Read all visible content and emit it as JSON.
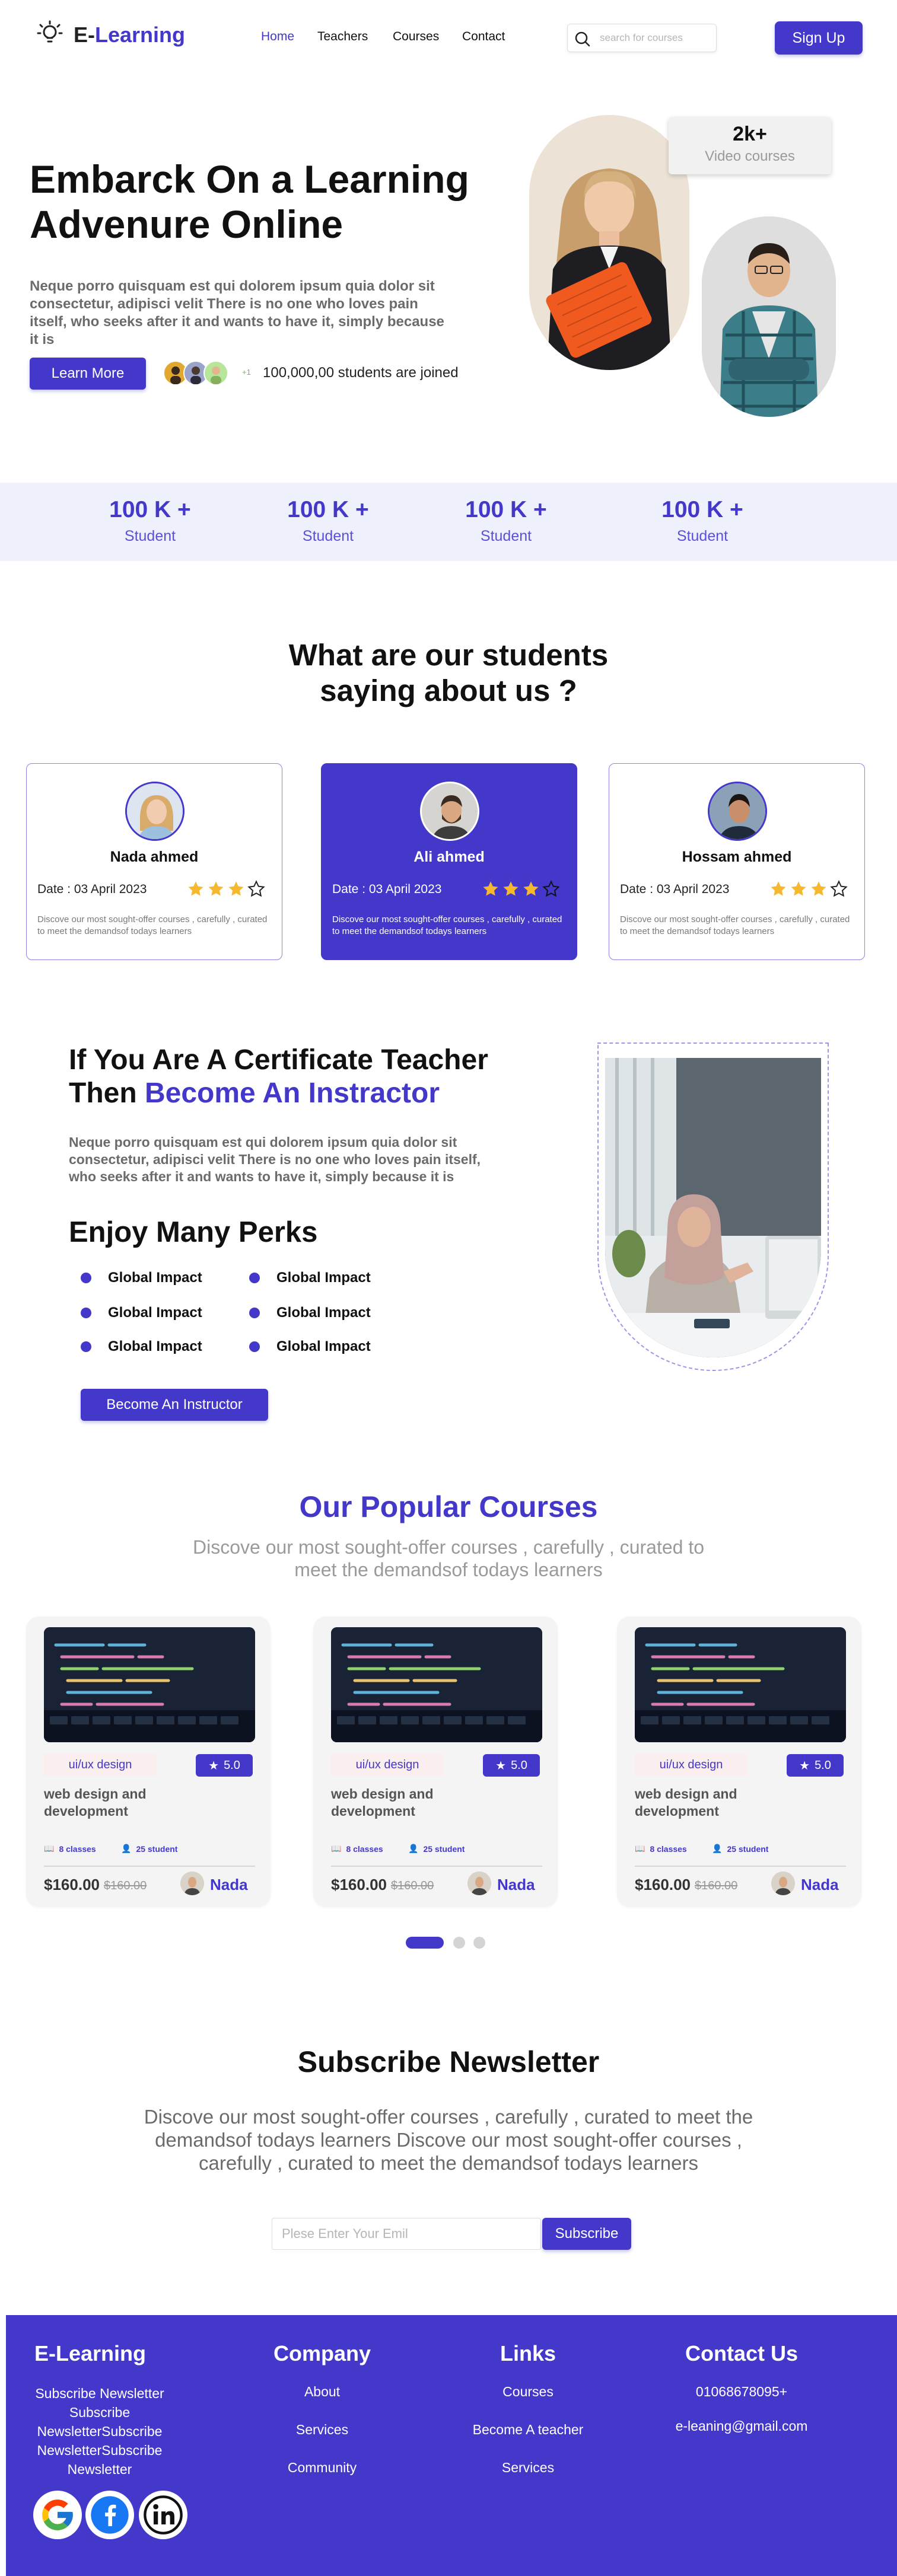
{
  "nav": {
    "logo_prefix": "E-",
    "logo_name": "Learning",
    "links": [
      "Home",
      "Teachers",
      "Courses",
      "Contact"
    ],
    "active": "Home",
    "search_placeholder": "search for courses",
    "signup_label": "Sign Up"
  },
  "hero": {
    "title": "Embarck On a Learning Advenure Online",
    "text": "Neque porro quisquam est qui dolorem ipsum quia dolor sit consectetur, adipisci velit There is no one who loves pain itself, who seeks after it and wants to have it, simply because it is",
    "learn_more": "Learn More",
    "avatars_more": "+1",
    "joined_text": "100,000,00 students are joined",
    "video_count": "2k+",
    "video_label": "Video courses"
  },
  "stats": [
    {
      "value": "100 K +",
      "label": "Student"
    },
    {
      "value": "100 K +",
      "label": "Student"
    },
    {
      "value": "100 K +",
      "label": "Student"
    },
    {
      "value": "100 K +",
      "label": "Student"
    }
  ],
  "testimonials": {
    "title_line1": "What are our students",
    "title_line2": "saying about us ?",
    "cards": [
      {
        "name": "Nada ahmed",
        "date": "Date : 03 April 2023",
        "stars": 3,
        "text": "Discove our most sought-offer courses , carefully , curated to meet the demandsof todays learners"
      },
      {
        "name": "Ali ahmed",
        "date": "Date : 03 April 2023",
        "stars": 3,
        "text": "Discove our most sought-offer courses , carefully , curated to meet the demandsof todays learners"
      },
      {
        "name": "Hossam ahmed",
        "date": "Date : 03 April 2023",
        "stars": 3,
        "text": "Discove our most sought-offer courses , carefully , curated to meet the demandsof todays learners"
      }
    ]
  },
  "instructor": {
    "title_line1": "If You Are A Certificate Teacher",
    "title_then": "Then ",
    "title_highlight": "Become An Instractor",
    "text": "Neque porro quisquam est qui dolorem ipsum quia dolor sit consectetur, adipisci velit There is no one who loves pain itself, who seeks after it and wants to have it, simply because it is",
    "perks_title": "Enjoy Many Perks",
    "perks": [
      "Global Impact",
      "Global Impact",
      "Global Impact",
      "Global Impact",
      "Global Impact",
      "Global Impact"
    ],
    "button": "Become An Instructor"
  },
  "courses": {
    "title": "Our Popular Courses",
    "subtitle": "Discove our most sought-offer courses , carefully , curated to meet the demandsof todays learners",
    "items": [
      {
        "category": "ui/ux design",
        "rating": "5.0",
        "title": "web design and development",
        "classes": "8 classes",
        "students": "25 student",
        "price": "$160.00",
        "old_price": "$160.00",
        "teacher": "Nada"
      },
      {
        "category": "ui/ux design",
        "rating": "5.0",
        "title": "web design and development",
        "classes": "8 classes",
        "students": "25 student",
        "price": "$160.00",
        "old_price": "$160.00",
        "teacher": "Nada"
      },
      {
        "category": "ui/ux design",
        "rating": "5.0",
        "title": "web design and development",
        "classes": "8 classes",
        "students": "25 student",
        "price": "$160.00",
        "old_price": "$160.00",
        "teacher": "Nada"
      }
    ]
  },
  "newsletter": {
    "title": "Subscribe Newsletter",
    "text": "Discove our most sought-offer courses , carefully , curated to meet the demandsof todays learners Discove our most sought-offer courses , carefully , curated to meet the demandsof todays learners",
    "placeholder": "Plese Enter Your Emil",
    "button": "Subscribe"
  },
  "footer": {
    "brand": "E-Learning",
    "brand_text": "Subscribe Newsletter Subscribe NewsletterSubscribe NewsletterSubscribe Newsletter",
    "company_title": "Company",
    "company_links": [
      "About",
      "Services",
      "Community"
    ],
    "links_title": "Links",
    "links": [
      "Courses",
      "Become A teacher",
      "Services"
    ],
    "contact_title": "Contact Us",
    "phone": "01068678095+",
    "email": "e-leaning@gmail.com",
    "social": [
      "google-icon",
      "facebook-icon",
      "linkedin-icon"
    ]
  },
  "colors": {
    "accent": "#4338ca",
    "band": "#eef0fc",
    "star": "#f5b82e"
  }
}
